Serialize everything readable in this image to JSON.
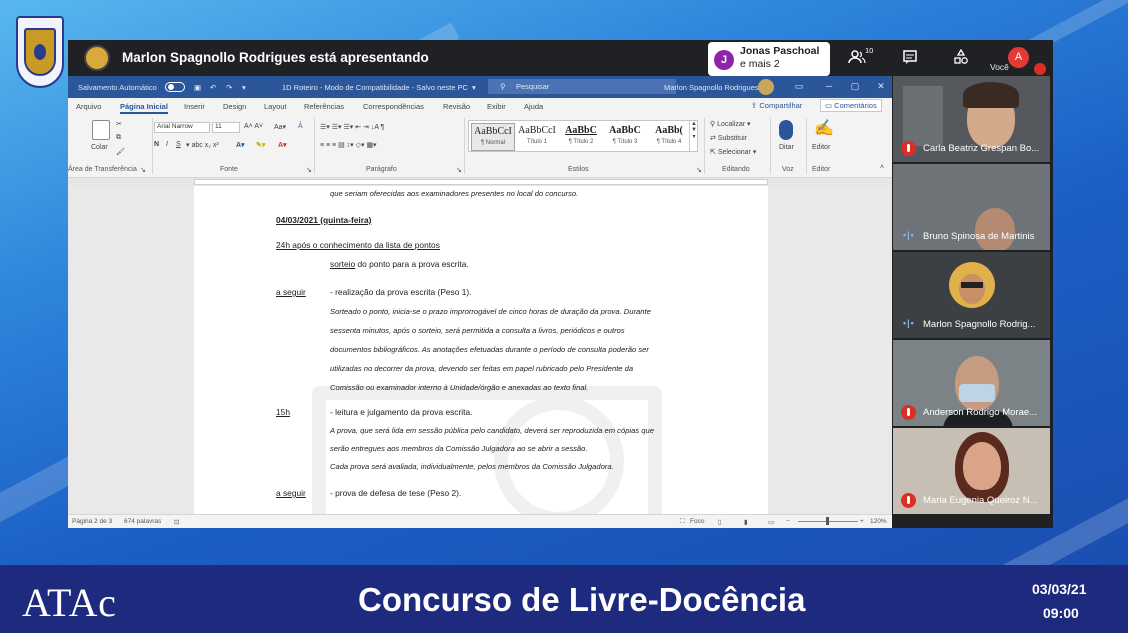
{
  "meet": {
    "presenter_title": "Marlon Spagnollo Rodrigues está apresentando",
    "pinned_initial": "J",
    "pinned_line1": "Jonas Paschoal",
    "pinned_line2": "e mais 2",
    "participants_count": "10",
    "you_label": "Você",
    "you_initial": "A"
  },
  "word": {
    "autosave_label": "Salvamento Automático",
    "doc_title": "1D Roteiro - Modo de Compatibilidade - Salvo neste PC",
    "search_placeholder": "Pesquisar",
    "user_name": "Marlon Spagnollo Rodrigues",
    "tabs": [
      "Arquivo",
      "Página Inicial",
      "Inserir",
      "Design",
      "Layout",
      "Referências",
      "Correspondências",
      "Revisão",
      "Exibir",
      "Ajuda"
    ],
    "share_label": "Compartilhar",
    "comments_label": "Comentários",
    "ribbon": {
      "paste_label": "Colar",
      "font_name": "Arial Narrow",
      "font_size": "11",
      "group_clipboard": "Área de Transferência",
      "group_font": "Fonte",
      "group_paragraph": "Parágrafo",
      "group_styles": "Estilos",
      "group_editing": "Editando",
      "group_voice": "Voz",
      "group_editor": "Editor",
      "styles": [
        {
          "sample": "AaBbCcI",
          "name": "¶ Normal"
        },
        {
          "sample": "AaBbCcI",
          "name": "Título 1"
        },
        {
          "sample": "AaBbC",
          "name": "¶ Título 2"
        },
        {
          "sample": "AaBbC",
          "name": "¶ Título 3"
        },
        {
          "sample": "AaBb(",
          "name": "¶ Título 4"
        }
      ],
      "find_label": "Localizar",
      "replace_label": "Substituir",
      "select_label": "Selecionar",
      "dictate_label": "Ditar",
      "editor_label": "Editor"
    },
    "doc_lines": {
      "l0": "que seriam oferecidas aos examinadores presentes no local do concurso.",
      "date": "04/03/2021 (quinta-feira)",
      "after24": "24h após o conhecimento da lista de pontos",
      "sorteio_word": "sorteio",
      "sorteio_rest": " do ponto para a prova escrita.",
      "aseguir1": "a seguir",
      "prova1": "- realização da prova escrita (Peso 1).",
      "p1a": "Sorteado o ponto, inicia-se o prazo improrrogável de cinco horas de duração da prova. Durante",
      "p1b": "sessenta minutos, após o sorteio, será permitida a consulta a livros, periódicos e outros",
      "p1c": "documentos bibliográficos. As anotações efetuadas durante o período de consulta poderão ser",
      "p1d": "utilizadas no decorrer da prova, devendo ser feitas em papel rubricado pelo Presidente da",
      "p1e": "Comissão ou examinador interno à Unidade/órgão e anexadas ao texto final.",
      "h15": "15h",
      "leitura": "- leitura e julgamento da prova escrita.",
      "p2a": "A prova, que será lida em sessão pública pelo candidato, deverá ser reproduzida em cópias que",
      "p2b": "serão entregues aos membros da Comissão Julgadora ao se abrir a sessão.",
      "p2c": "Cada prova será avaliada, individualmente, pelos membros da Comissão Julgadora.",
      "aseguir2": "a seguir",
      "prova2": "- prova de defesa de tese (Peso 2)."
    },
    "status": {
      "page": "Página 2 de 3",
      "words": "674 palavras",
      "focus": "Foco",
      "zoom": "120%"
    }
  },
  "participants": [
    {
      "name": "Carla Beatriz Grespan Bo...",
      "muted": true
    },
    {
      "name": "Bruno Spinosa de Martinis",
      "muted": false
    },
    {
      "name": "Marlon Spagnollo Rodrig...",
      "muted": false
    },
    {
      "name": "Anderson Rodrigo Morae...",
      "muted": true
    },
    {
      "name": "Maria Eugenia Queiroz N...",
      "muted": true
    }
  ],
  "footer": {
    "logo": "ATAc",
    "title": "Concurso de Livre-Docência",
    "date": "03/03/21",
    "time": "09:00"
  },
  "colors": {
    "word_blue": "#2b579a",
    "footer_navy": "#1e2a7e",
    "meet_dark": "#202124",
    "mute_red": "#d93025"
  }
}
